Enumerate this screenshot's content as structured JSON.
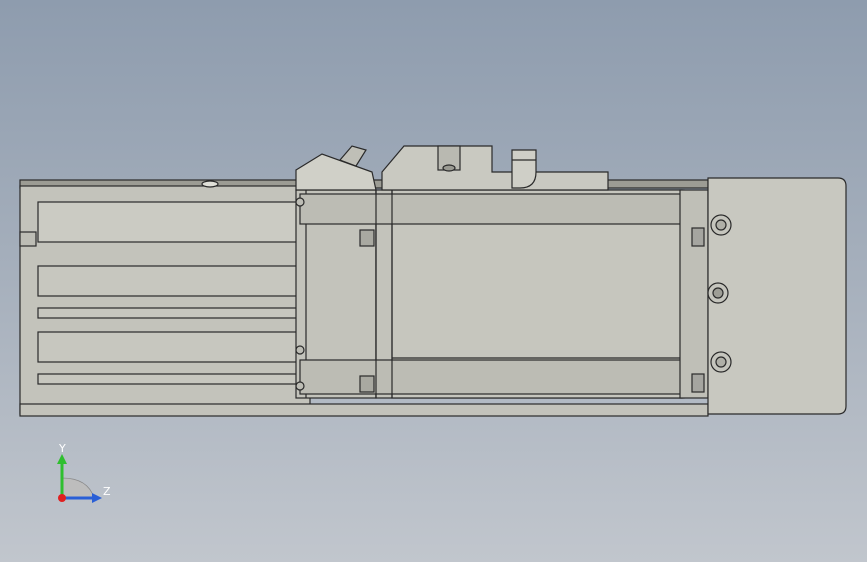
{
  "viewport": {
    "background_top": "#8e9cae",
    "background_bottom": "#c1c6cd"
  },
  "model": {
    "body_color": "#c3c3bb",
    "edge_color": "#2a2a2a",
    "shade_color": "#a9a9a1"
  },
  "triad": {
    "y_label": "Y",
    "z_label": "Z",
    "y_color": "#2fbf2f",
    "z_color": "#2a5fd6",
    "x_color": "#e02020"
  }
}
